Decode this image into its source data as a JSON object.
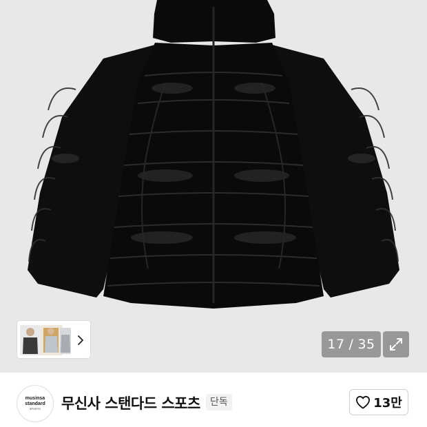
{
  "gallery": {
    "image_icon": "black-padded-down-jacket-photo",
    "counter": {
      "current": "17",
      "separator": "/",
      "total": "35"
    },
    "thumbnail_icon": "model-photo-thumbnails",
    "next_icon": "chevron-right-icon",
    "expand_icon": "expand-arrows-icon"
  },
  "brand": {
    "logo_text": {
      "line1": "musinsa",
      "line2": "standard",
      "line3": "SPORTS"
    },
    "name": "무신사 스탠다드 스포츠",
    "badge": "단독"
  },
  "like": {
    "icon": "heart-outline-icon",
    "count": "13만"
  },
  "colors": {
    "gallery_bg": "#e8e8e8",
    "jacket": "#0d0d0d",
    "overlay": "rgba(120,120,120,0.72)",
    "text": "#111111"
  }
}
